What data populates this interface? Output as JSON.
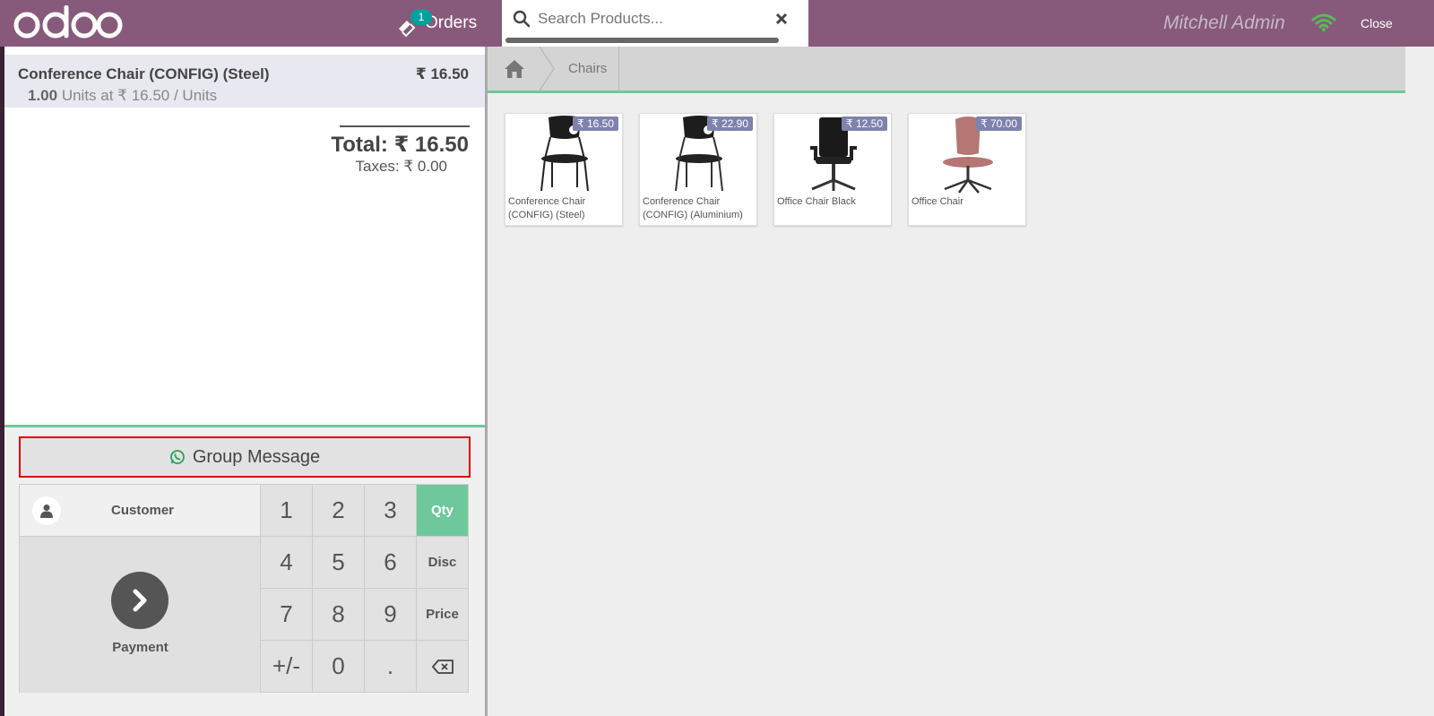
{
  "header": {
    "orders_label": "Orders",
    "orders_count": "1",
    "search_placeholder": "Search Products...",
    "user_name": "Mitchell Admin",
    "close_label": "Close"
  },
  "order": {
    "line": {
      "name": "Conference Chair (CONFIG) (Steel)",
      "price": "₹ 16.50",
      "qty": "1.00",
      "unit_detail": "Units at ₹ 16.50 / Units"
    },
    "total": "Total: ₹ 16.50",
    "taxes": "Taxes: ₹ 0.00"
  },
  "controls": {
    "group_message": "Group Message",
    "customer": "Customer",
    "payment": "Payment",
    "keys": [
      "1",
      "2",
      "3",
      "4",
      "5",
      "6",
      "7",
      "8",
      "9",
      "+/-",
      "0",
      "."
    ],
    "modes": [
      "Qty",
      "Disc",
      "Price"
    ]
  },
  "breadcrumb": {
    "category": "Chairs"
  },
  "products": [
    {
      "name": "Conference Chair (CONFIG) (Steel)",
      "price": "₹ 16.50"
    },
    {
      "name": "Conference Chair (CONFIG) (Aluminium)",
      "price": "₹ 22.90"
    },
    {
      "name": "Office Chair Black",
      "price": "₹ 12.50"
    },
    {
      "name": "Office Chair",
      "price": "₹ 70.00"
    }
  ],
  "colors": {
    "header": "#875a7b",
    "accent": "#6ec89b",
    "price_tag": "#7f82ac",
    "highlight_border": "#e00000"
  }
}
